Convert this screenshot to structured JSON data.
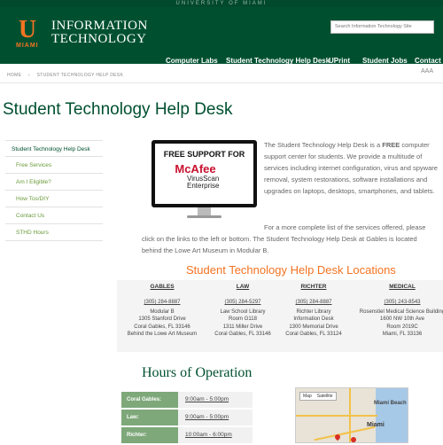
{
  "top_strip": "UNIVERSITY OF MIAMI",
  "logo": {
    "letter": "U",
    "miami": "MIAMI"
  },
  "site_title": {
    "line1": "INFORMATION",
    "line2": "TECHNOLOGY"
  },
  "search": {
    "placeholder": "Search Information Technology Site"
  },
  "nav": [
    "Computer Labs",
    "Student Technology Help Desk",
    "UPrint",
    "Student Jobs",
    "Contact U"
  ],
  "text_size": "AAA",
  "breadcrumb": {
    "home": "HOME",
    "sep": "›",
    "current": "STUDENT TECHNOLOGY HELP DESK"
  },
  "page_title": "Student Technology Help Desk",
  "sidenav": [
    "Student Technology Help Desk",
    "Free Services",
    "Am I Eligible?",
    "How Tos/DIY",
    "Contact Us",
    "STHD Hours"
  ],
  "promo": {
    "headline": "FREE SUPPORT FOR",
    "brand": "McAfee",
    "product1": "VirusScan",
    "product2": "Enterprise"
  },
  "intro": {
    "pre": "The Student Technology Help Desk is a ",
    "free": "FREE",
    "post": " computer support center for students. We provide a multitude of services including internet configuration, virus and spyware removal, system restorations, software installations and upgrades on laptops, desktops, smartphones, and tablets."
  },
  "more": {
    "line1": "For a more complete list of the services offered, please",
    "line2": "click on the links to the left or bottom. The Student Technology Help Desk at Gables is located",
    "line3": "behind the Lowe Art Museum in Modular B."
  },
  "locations_title": "Student Technology Help Desk Locations",
  "locations": [
    {
      "name": "GABLES",
      "phone": "(305) 284-8887",
      "lines": [
        "Modular B",
        "1305 Stanford Drive",
        "Coral Gables, FL 33146",
        "Behind the Lowe Art Museum"
      ]
    },
    {
      "name": "LAW",
      "phone": "(305) 284-5297",
      "lines": [
        "Law School Library",
        "Room G118",
        "1311 Miller Drive",
        "Coral Gables, FL 33146"
      ]
    },
    {
      "name": "RICHTER",
      "phone": "(305) 284-8887",
      "lines": [
        "Richter Library",
        "Information Desk",
        "1300 Memorial Drive",
        "Coral Gables, FL 33124"
      ]
    },
    {
      "name": "MEDICAL",
      "phone": "(305) 243-8543",
      "lines": [
        "Rosenstiel Medical Science Building",
        "1600 NW 10th Ave",
        "Room 2019C",
        "Miami, FL 33136"
      ]
    }
  ],
  "hours_title": "Hours of Operation",
  "hours": [
    {
      "place": "Coral Gables:",
      "time": "9:00am - 5:00pm"
    },
    {
      "place": "Law:",
      "time": "9:00am - 5:00pm"
    },
    {
      "place": "Richter:",
      "time": "10:00am - 6:00pm"
    }
  ],
  "map": {
    "tab1": "Map",
    "tab2": "Satellite",
    "label_top": "Miami Beach",
    "label_city": "Miami"
  }
}
